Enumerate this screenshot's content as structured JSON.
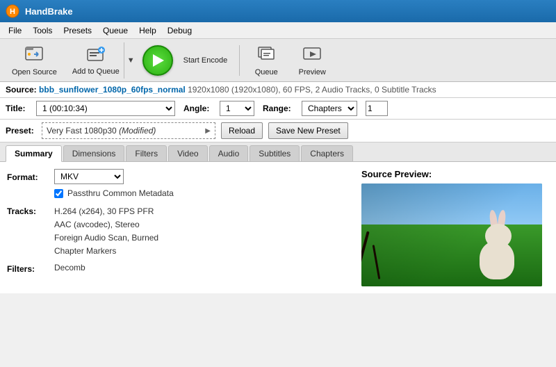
{
  "titlebar": {
    "appname": "HandBrake"
  },
  "menubar": {
    "items": [
      "File",
      "Tools",
      "Presets",
      "Queue",
      "Help",
      "Debug"
    ]
  },
  "toolbar": {
    "open_source": "Open Source",
    "add_to_queue": "Add to Queue",
    "start_encode": "Start Encode",
    "queue": "Queue",
    "preview": "Preview"
  },
  "source": {
    "label": "Source:",
    "filename": "bbb_sunflower_1080p_60fps_normal",
    "meta": "1920x1080 (1920x1080), 60 FPS, 2 Audio Tracks, 0 Subtitle Tracks"
  },
  "title": {
    "label": "Title:",
    "value": "1 (00:10:34)",
    "angle_label": "Angle:",
    "angle_value": "1",
    "range_label": "Range:",
    "range_value": "Chapters",
    "range_num": "1"
  },
  "preset": {
    "label": "Preset:",
    "name": "Very Fast 1080p30 (Modified)",
    "reload_btn": "Reload",
    "save_btn": "Save New Preset"
  },
  "tabs": {
    "items": [
      "Summary",
      "Dimensions",
      "Filters",
      "Video",
      "Audio",
      "Subtitles",
      "Chapters"
    ],
    "active": "Summary"
  },
  "summary": {
    "format_label": "Format:",
    "format_value": "MKV",
    "metadata_label": "Passthru Common Metadata",
    "tracks_label": "Tracks:",
    "tracks": [
      "H.264 (x264), 30 FPS PFR",
      "AAC (avcodec), Stereo",
      "Foreign Audio Scan, Burned",
      "Chapter Markers"
    ],
    "filters_label": "Filters:",
    "filters_value": "Decomb",
    "preview_label": "Source Preview:"
  }
}
